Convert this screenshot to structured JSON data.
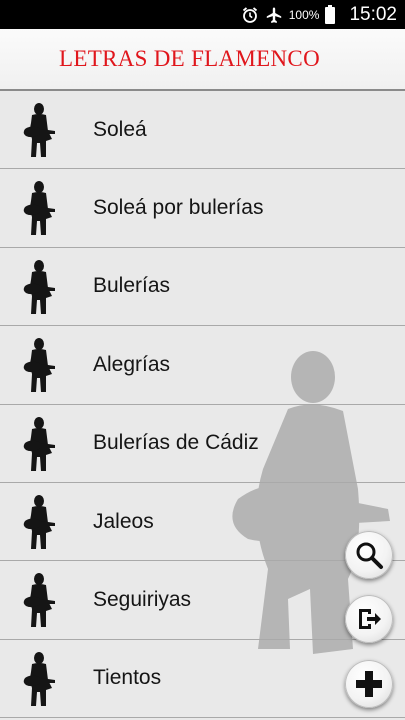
{
  "status_bar": {
    "battery_percent": "100%",
    "time": "15:02",
    "icons": [
      "alarm-icon",
      "airplane-mode-icon",
      "battery-icon"
    ]
  },
  "header": {
    "title": "LETRAS DE FLAMENCO"
  },
  "colors": {
    "title_red": "#e0161c",
    "list_background": "#e9e9e9",
    "divider": "#a9a9a9"
  },
  "items": [
    {
      "label": "Soleá",
      "icon": "guitarist-icon"
    },
    {
      "label": "Soleá por bulerías",
      "icon": "guitarist-icon"
    },
    {
      "label": "Bulerías",
      "icon": "guitarist-icon"
    },
    {
      "label": "Alegrías",
      "icon": "guitarist-icon"
    },
    {
      "label": "Bulerías de Cádiz",
      "icon": "guitarist-icon"
    },
    {
      "label": "Jaleos",
      "icon": "guitarist-icon"
    },
    {
      "label": "Seguiriyas",
      "icon": "guitarist-icon"
    },
    {
      "label": "Tientos",
      "icon": "guitarist-icon"
    }
  ],
  "actions": [
    {
      "name": "search",
      "icon": "search-icon"
    },
    {
      "name": "share",
      "icon": "share-icon"
    },
    {
      "name": "add",
      "icon": "add-icon"
    }
  ]
}
